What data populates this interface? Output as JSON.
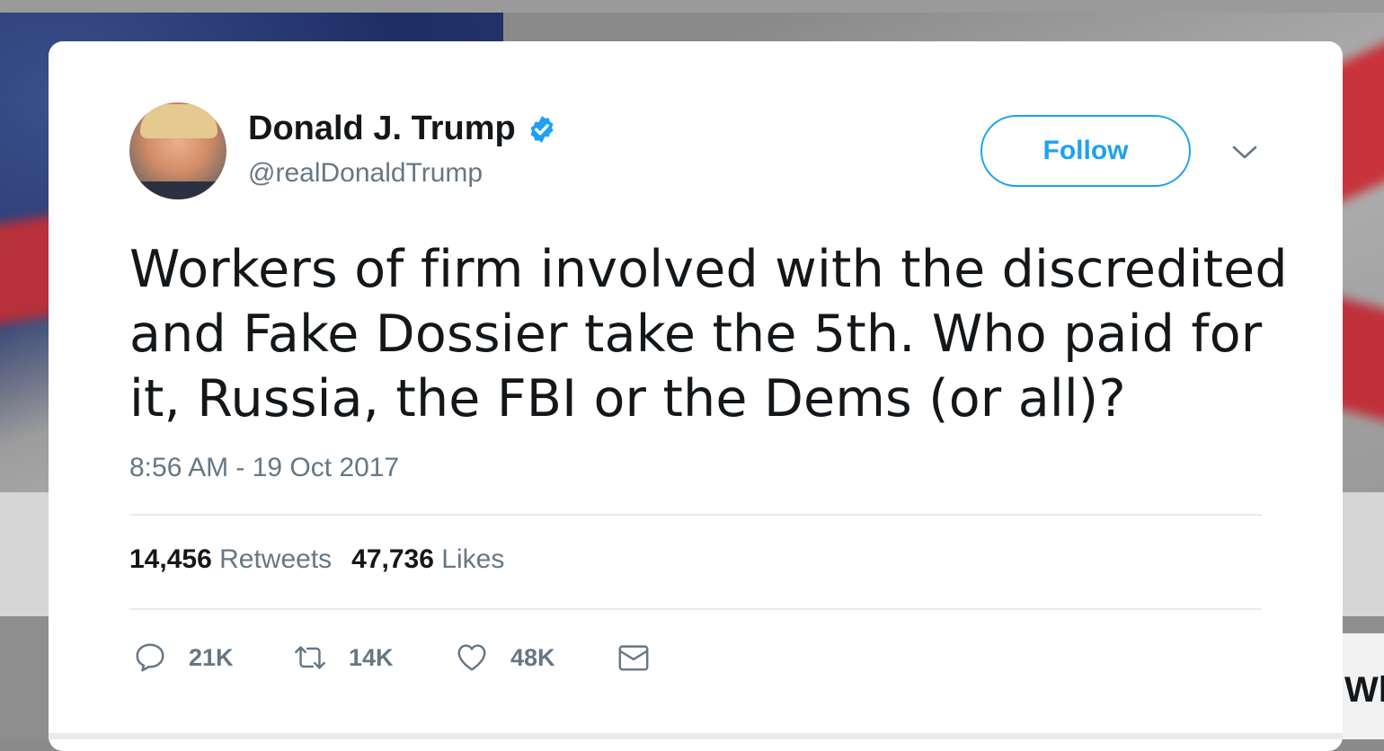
{
  "user": {
    "name": "Donald J. Trump",
    "handle": "@realDonaldTrump",
    "verified": true
  },
  "follow_button": {
    "label": "Follow"
  },
  "tweet": {
    "text": "Workers of firm involved with the discredited and Fake Dossier take the 5th. Who paid for it, Russia, the FBI or the Dems (or all)?",
    "timestamp": "8:56 AM - 19 Oct 2017"
  },
  "stats": {
    "retweets_count": "14,456",
    "retweets_label": "Retweets",
    "likes_count": "47,736",
    "likes_label": "Likes"
  },
  "actions": {
    "reply": {
      "icon": "reply-icon",
      "count": "21K"
    },
    "retweet": {
      "icon": "retweet-icon",
      "count": "14K"
    },
    "like": {
      "icon": "heart-icon",
      "count": "48K"
    },
    "dm": {
      "icon": "envelope-icon"
    }
  },
  "background": {
    "partial_text": "Wh"
  },
  "colors": {
    "accent": "#1da1f2",
    "text": "#14171a",
    "muted": "#657786",
    "divider": "#e6ecf0"
  }
}
